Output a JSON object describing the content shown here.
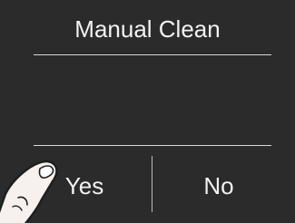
{
  "dialog": {
    "title": "Manual Clean",
    "yes_label": "Yes",
    "no_label": "No"
  },
  "colors": {
    "background": "#2b2b2b",
    "text": "#f2f2f2",
    "divider": "#d8d8d8"
  },
  "icons": {
    "pointer": "finger-pointer-icon"
  }
}
